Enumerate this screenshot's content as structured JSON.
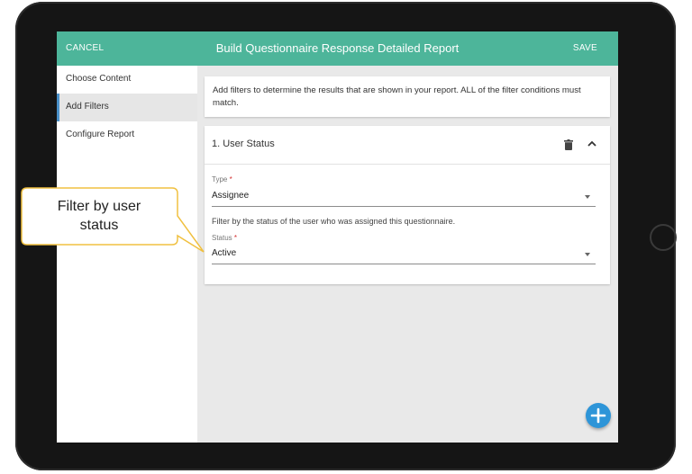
{
  "appbar": {
    "cancel_label": "CANCEL",
    "title": "Build Questionnaire Response Detailed  Report",
    "save_label": "SAVE",
    "color": "#4db59a"
  },
  "sidebar": {
    "items": [
      {
        "label": "Choose Content",
        "active": false
      },
      {
        "label": "Add Filters",
        "active": true
      },
      {
        "label": "Configure Report",
        "active": false
      }
    ]
  },
  "info": {
    "text": "Add filters to determine the results that are shown in your report. ALL of the filter conditions must match."
  },
  "filter": {
    "title": "1. User Status",
    "type_label": "Type",
    "type_value": "Assignee",
    "helper_text": "Filter by the status of the user who was assigned this questionnaire.",
    "status_label": "Status",
    "status_value": "Active",
    "required_marker": "*",
    "icons": [
      "trash-icon",
      "chevron-up-icon"
    ]
  },
  "fab": {
    "icon": "plus-icon",
    "color": "#2e95d8"
  },
  "callout": {
    "text_line1": "Filter by user",
    "text_line2": "status",
    "border_color": "#f0c040"
  }
}
